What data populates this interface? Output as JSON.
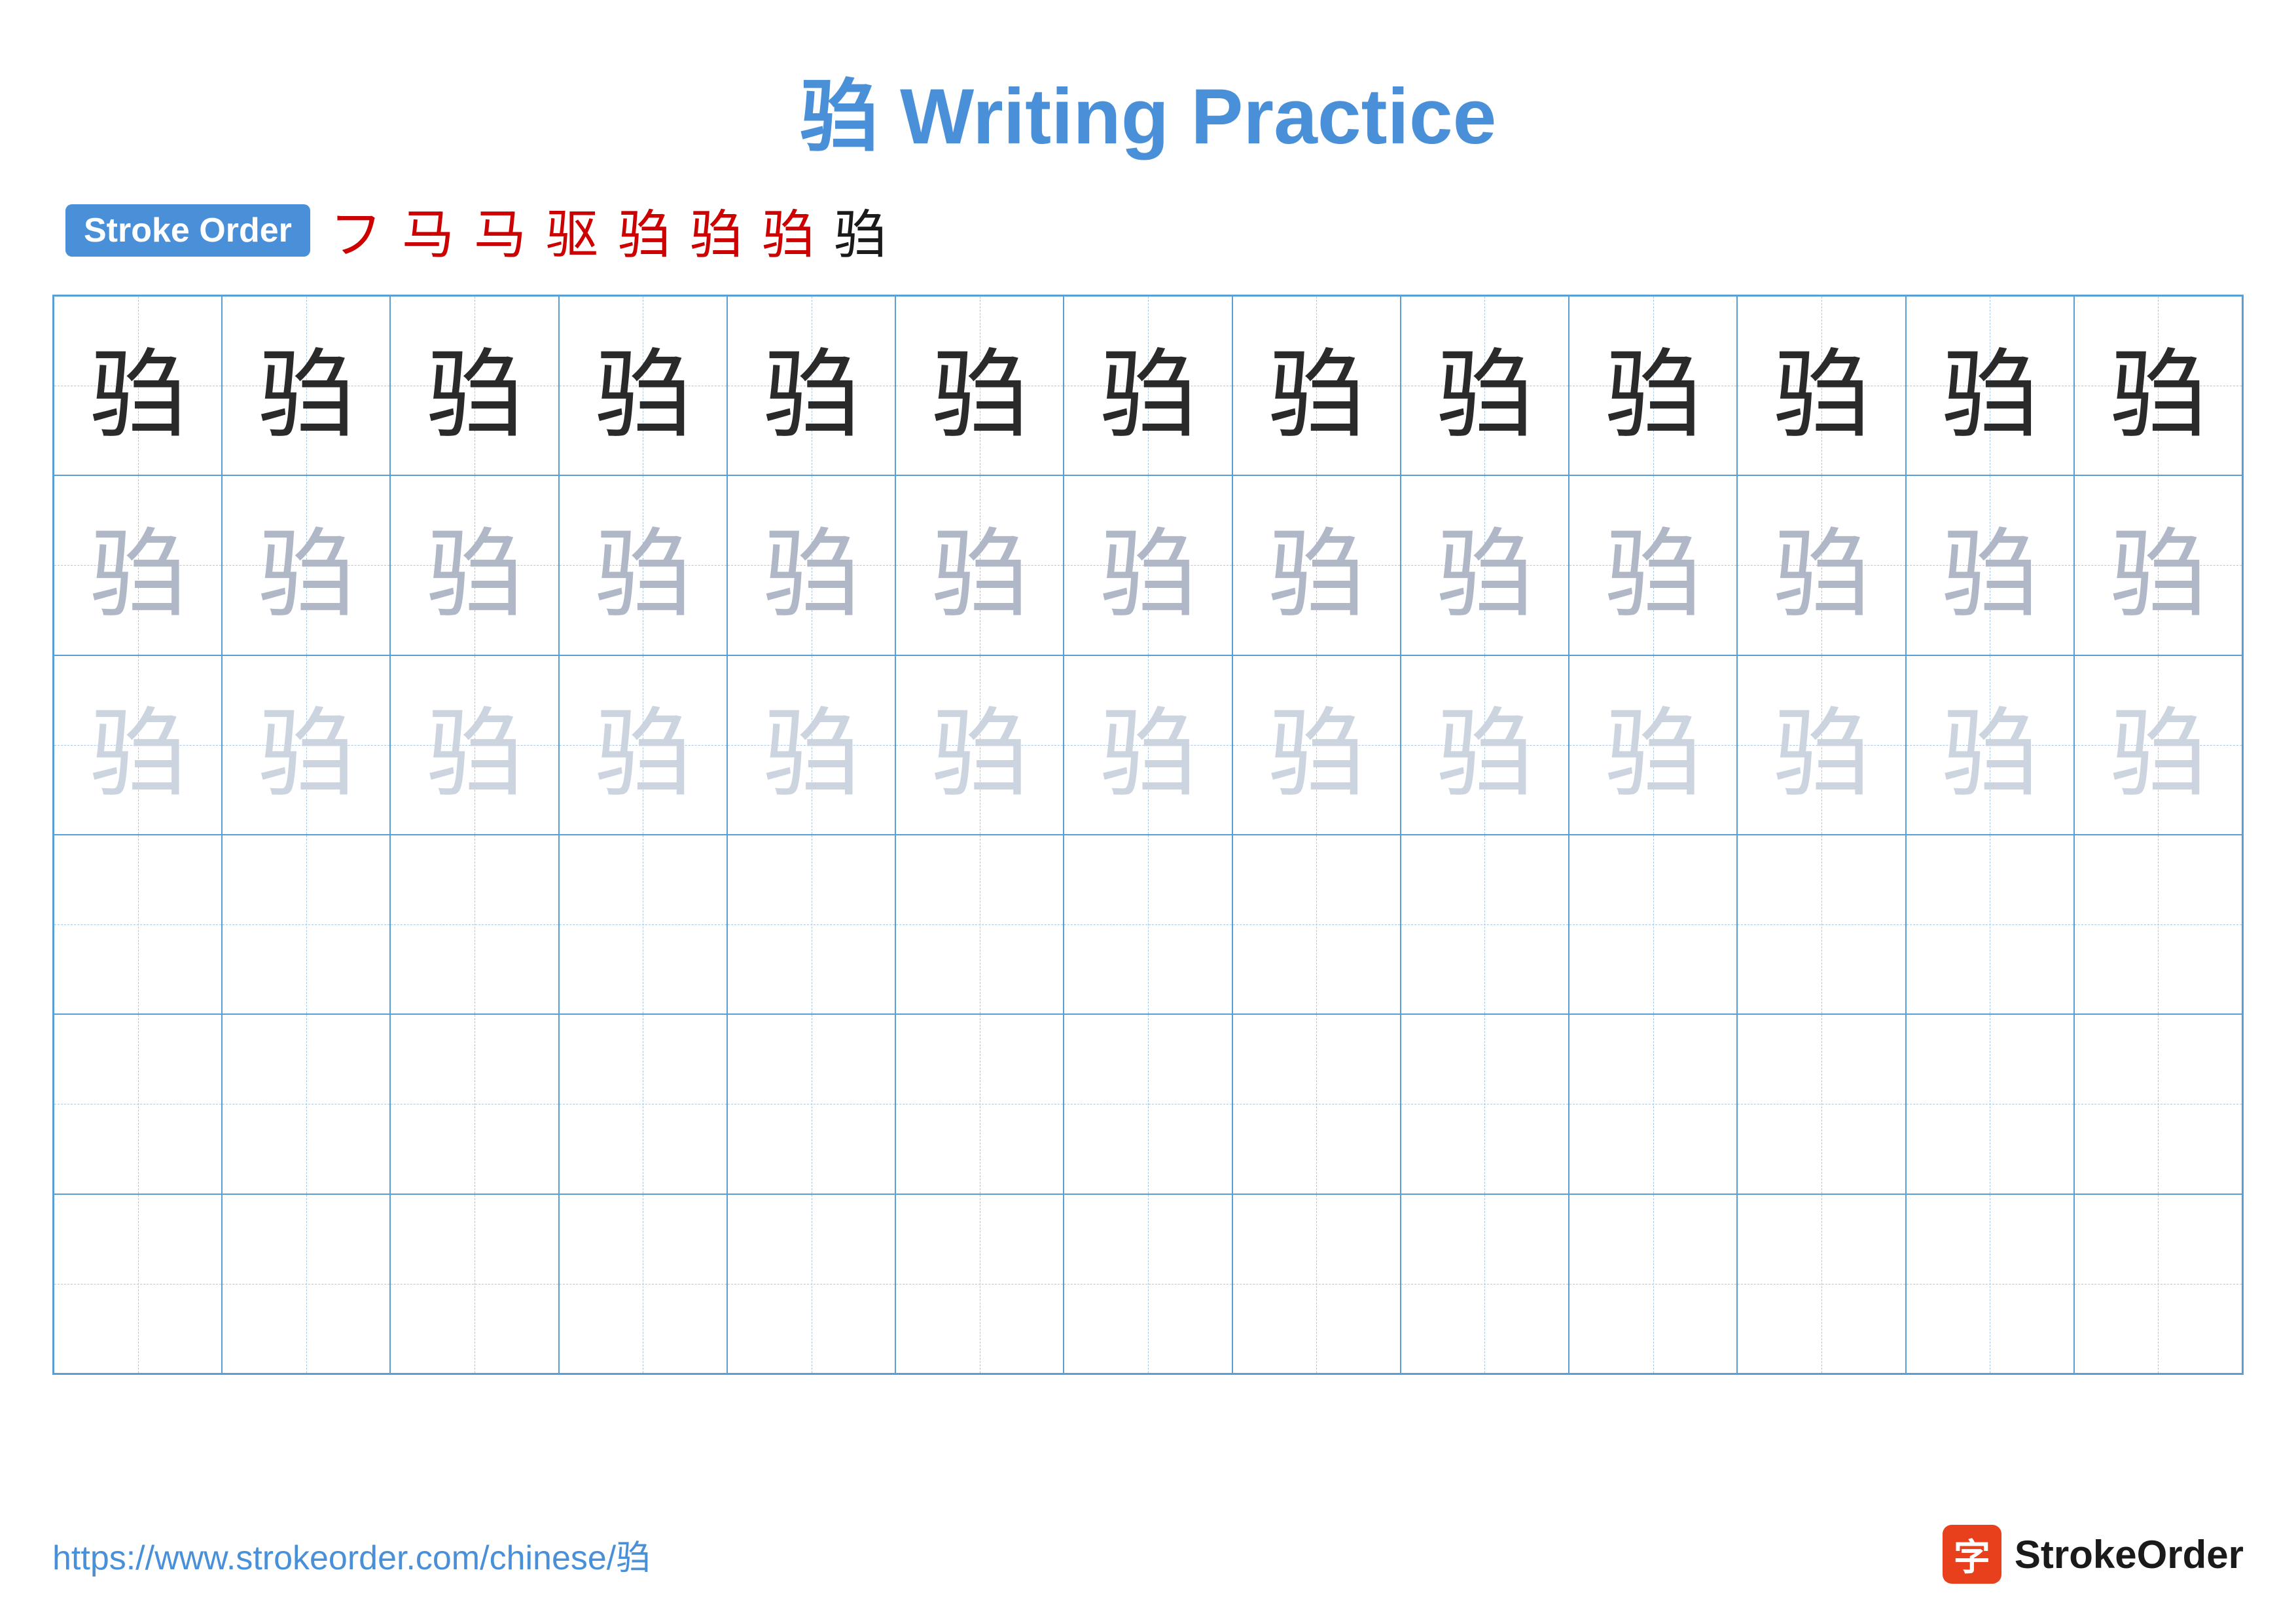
{
  "title": "驺 Writing Practice",
  "stroke_order_label": "Stroke Order",
  "stroke_sequence": [
    "フ",
    "马",
    "马",
    "驱",
    "驺",
    "驺",
    "驺",
    "驺"
  ],
  "stroke_sequence_colors": [
    "red",
    "red",
    "red",
    "red",
    "red",
    "red",
    "red",
    "black"
  ],
  "main_char": "驺",
  "grid": {
    "cols": 13,
    "rows": 6,
    "row_configs": [
      {
        "type": "dark",
        "count": 13
      },
      {
        "type": "medium-gray",
        "count": 13
      },
      {
        "type": "light-gray",
        "count": 13
      },
      {
        "type": "empty",
        "count": 13
      },
      {
        "type": "empty",
        "count": 13
      },
      {
        "type": "empty",
        "count": 13
      }
    ]
  },
  "footer": {
    "url": "https://www.strokeorder.com/chinese/驺",
    "brand_label": "StrokeOrder",
    "brand_char": "字"
  }
}
